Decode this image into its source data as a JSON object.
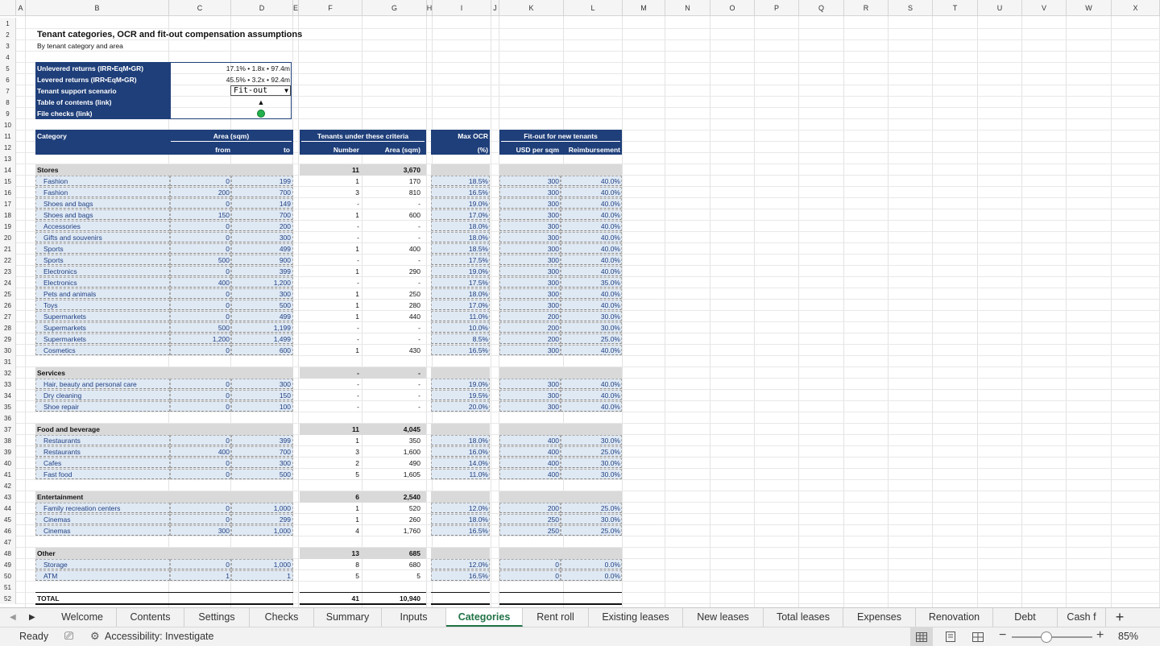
{
  "columns": [
    "A",
    "B",
    "C",
    "D",
    "E",
    "F",
    "G",
    "H",
    "I",
    "J",
    "K",
    "L",
    "M",
    "N",
    "O",
    "P",
    "Q",
    "R",
    "S",
    "T",
    "U",
    "V",
    "W",
    "X"
  ],
  "rows": [
    "1",
    "2",
    "3",
    "4",
    "5",
    "6",
    "7",
    "8",
    "9",
    "10",
    "11",
    "12",
    "13",
    "14",
    "15",
    "16",
    "17",
    "18",
    "19",
    "20",
    "21",
    "22",
    "23",
    "24",
    "25",
    "26",
    "27",
    "28",
    "29",
    "30",
    "31",
    "32",
    "33",
    "34",
    "35",
    "36",
    "37",
    "38",
    "39",
    "40",
    "41",
    "42",
    "43",
    "44",
    "45",
    "46",
    "47",
    "48",
    "49",
    "50",
    "51",
    "52"
  ],
  "title": "Tenant categories, OCR and fit-out compensation assumptions",
  "subtitle": "By tenant category and area",
  "summary": [
    {
      "label": "Unlevered returns (IRR•EqM•GR)",
      "value": "17.1% • 1.8x • 97.4m"
    },
    {
      "label": "Levered returns (IRR•EqM•GR)",
      "value": "45.5% • 3.2x • 92.4m"
    },
    {
      "label": "Tenant support scenario",
      "value": "Fit-out"
    },
    {
      "label": "Table of contents (link)",
      "value": "▲"
    },
    {
      "label": "File checks (link)",
      "value": ""
    }
  ],
  "headers": {
    "category": "Category",
    "area": "Area (sqm)",
    "from": "from",
    "to": "to",
    "tenants": "Tenants under these criteria",
    "number": "Number",
    "tenant_area": "Area (sqm)",
    "maxocr": "Max OCR",
    "pct": "(%)",
    "fitout": "Fit-out for new tenants",
    "usd": "USD per sqm",
    "reimb": "Reimbursement"
  },
  "groups": [
    {
      "name": "Stores",
      "number": "11",
      "area": "3,670",
      "items": [
        {
          "cat": "Fashion",
          "from": "0",
          "to": "199",
          "n": "1",
          "a": "170",
          "ocr": "18.5%",
          "usd": "300",
          "reimb": "40.0%"
        },
        {
          "cat": "Fashion",
          "from": "200",
          "to": "700",
          "n": "3",
          "a": "810",
          "ocr": "16.5%",
          "usd": "300",
          "reimb": "40.0%"
        },
        {
          "cat": "Shoes and bags",
          "from": "0",
          "to": "149",
          "n": "-",
          "a": "-",
          "ocr": "19.0%",
          "usd": "300",
          "reimb": "40.0%"
        },
        {
          "cat": "Shoes and bags",
          "from": "150",
          "to": "700",
          "n": "1",
          "a": "600",
          "ocr": "17.0%",
          "usd": "300",
          "reimb": "40.0%"
        },
        {
          "cat": "Accessories",
          "from": "0",
          "to": "200",
          "n": "-",
          "a": "-",
          "ocr": "18.0%",
          "usd": "300",
          "reimb": "40.0%"
        },
        {
          "cat": "Gifts and souvenirs",
          "from": "0",
          "to": "300",
          "n": "-",
          "a": "-",
          "ocr": "18.0%",
          "usd": "300",
          "reimb": "40.0%"
        },
        {
          "cat": "Sports",
          "from": "0",
          "to": "499",
          "n": "1",
          "a": "400",
          "ocr": "18.5%",
          "usd": "300",
          "reimb": "40.0%"
        },
        {
          "cat": "Sports",
          "from": "500",
          "to": "900",
          "n": "-",
          "a": "-",
          "ocr": "17.5%",
          "usd": "300",
          "reimb": "40.0%"
        },
        {
          "cat": "Electronics",
          "from": "0",
          "to": "399",
          "n": "1",
          "a": "290",
          "ocr": "19.0%",
          "usd": "300",
          "reimb": "40.0%"
        },
        {
          "cat": "Electronics",
          "from": "400",
          "to": "1,200",
          "n": "-",
          "a": "-",
          "ocr": "17.5%",
          "usd": "300",
          "reimb": "35.0%"
        },
        {
          "cat": "Pets and animals",
          "from": "0",
          "to": "300",
          "n": "1",
          "a": "250",
          "ocr": "18.0%",
          "usd": "300",
          "reimb": "40.0%"
        },
        {
          "cat": "Toys",
          "from": "0",
          "to": "500",
          "n": "1",
          "a": "280",
          "ocr": "17.0%",
          "usd": "300",
          "reimb": "40.0%"
        },
        {
          "cat": "Supermarkets",
          "from": "0",
          "to": "499",
          "n": "1",
          "a": "440",
          "ocr": "11.0%",
          "usd": "200",
          "reimb": "30.0%"
        },
        {
          "cat": "Supermarkets",
          "from": "500",
          "to": "1,199",
          "n": "-",
          "a": "-",
          "ocr": "10.0%",
          "usd": "200",
          "reimb": "30.0%"
        },
        {
          "cat": "Supermarkets",
          "from": "1,200",
          "to": "1,499",
          "n": "-",
          "a": "-",
          "ocr": "8.5%",
          "usd": "200",
          "reimb": "25.0%"
        },
        {
          "cat": "Cosmetics",
          "from": "0",
          "to": "600",
          "n": "1",
          "a": "430",
          "ocr": "16.5%",
          "usd": "300",
          "reimb": "40.0%"
        }
      ]
    },
    {
      "name": "Services",
      "number": "-",
      "area": "-",
      "items": [
        {
          "cat": "Hair, beauty and personal care",
          "from": "0",
          "to": "300",
          "n": "-",
          "a": "-",
          "ocr": "19.0%",
          "usd": "300",
          "reimb": "40.0%"
        },
        {
          "cat": "Dry cleaning",
          "from": "0",
          "to": "150",
          "n": "-",
          "a": "-",
          "ocr": "19.5%",
          "usd": "300",
          "reimb": "40.0%"
        },
        {
          "cat": "Shoe repair",
          "from": "0",
          "to": "100",
          "n": "-",
          "a": "-",
          "ocr": "20.0%",
          "usd": "300",
          "reimb": "40.0%"
        }
      ]
    },
    {
      "name": "Food and beverage",
      "number": "11",
      "area": "4,045",
      "items": [
        {
          "cat": "Restaurants",
          "from": "0",
          "to": "399",
          "n": "1",
          "a": "350",
          "ocr": "18.0%",
          "usd": "400",
          "reimb": "30.0%"
        },
        {
          "cat": "Restaurants",
          "from": "400",
          "to": "700",
          "n": "3",
          "a": "1,600",
          "ocr": "16.0%",
          "usd": "400",
          "reimb": "25.0%"
        },
        {
          "cat": "Cafes",
          "from": "0",
          "to": "300",
          "n": "2",
          "a": "490",
          "ocr": "14.0%",
          "usd": "400",
          "reimb": "30.0%"
        },
        {
          "cat": "Fast food",
          "from": "0",
          "to": "500",
          "n": "5",
          "a": "1,605",
          "ocr": "11.0%",
          "usd": "400",
          "reimb": "30.0%"
        }
      ]
    },
    {
      "name": "Entertainment",
      "number": "6",
      "area": "2,540",
      "items": [
        {
          "cat": "Family recreation centers",
          "from": "0",
          "to": "1,000",
          "n": "1",
          "a": "520",
          "ocr": "12.0%",
          "usd": "200",
          "reimb": "25.0%"
        },
        {
          "cat": "Cinemas",
          "from": "0",
          "to": "299",
          "n": "1",
          "a": "260",
          "ocr": "18.0%",
          "usd": "250",
          "reimb": "30.0%"
        },
        {
          "cat": "Cinemas",
          "from": "300",
          "to": "1,000",
          "n": "4",
          "a": "1,760",
          "ocr": "16.5%",
          "usd": "250",
          "reimb": "25.0%"
        }
      ]
    },
    {
      "name": "Other",
      "number": "13",
      "area": "685",
      "items": [
        {
          "cat": "Storage",
          "from": "0",
          "to": "1,000",
          "n": "8",
          "a": "680",
          "ocr": "12.0%",
          "usd": "0",
          "reimb": "0.0%"
        },
        {
          "cat": "ATM",
          "from": "1",
          "to": "1",
          "n": "5",
          "a": "5",
          "ocr": "16.5%",
          "usd": "0",
          "reimb": "0.0%"
        }
      ]
    }
  ],
  "total": {
    "label": "TOTAL",
    "number": "41",
    "area": "10,940"
  },
  "tabs": [
    "Welcome",
    "Contents",
    "Settings",
    "Checks",
    "Summary",
    "Inputs",
    "Categories",
    "Rent roll",
    "Existing leases",
    "New leases",
    "Total leases",
    "Expenses",
    "Renovation",
    "Debt",
    "Cash f"
  ],
  "active_tab": "Categories",
  "status": {
    "ready": "Ready",
    "accessibility": "Accessibility: Investigate",
    "zoom": "85%"
  },
  "colors": {
    "navy": "#1f3f7a",
    "input_fill": "#dfe9f4",
    "band": "#d9d9d9",
    "excel_green": "#217346",
    "check_green": "#22b14c"
  }
}
